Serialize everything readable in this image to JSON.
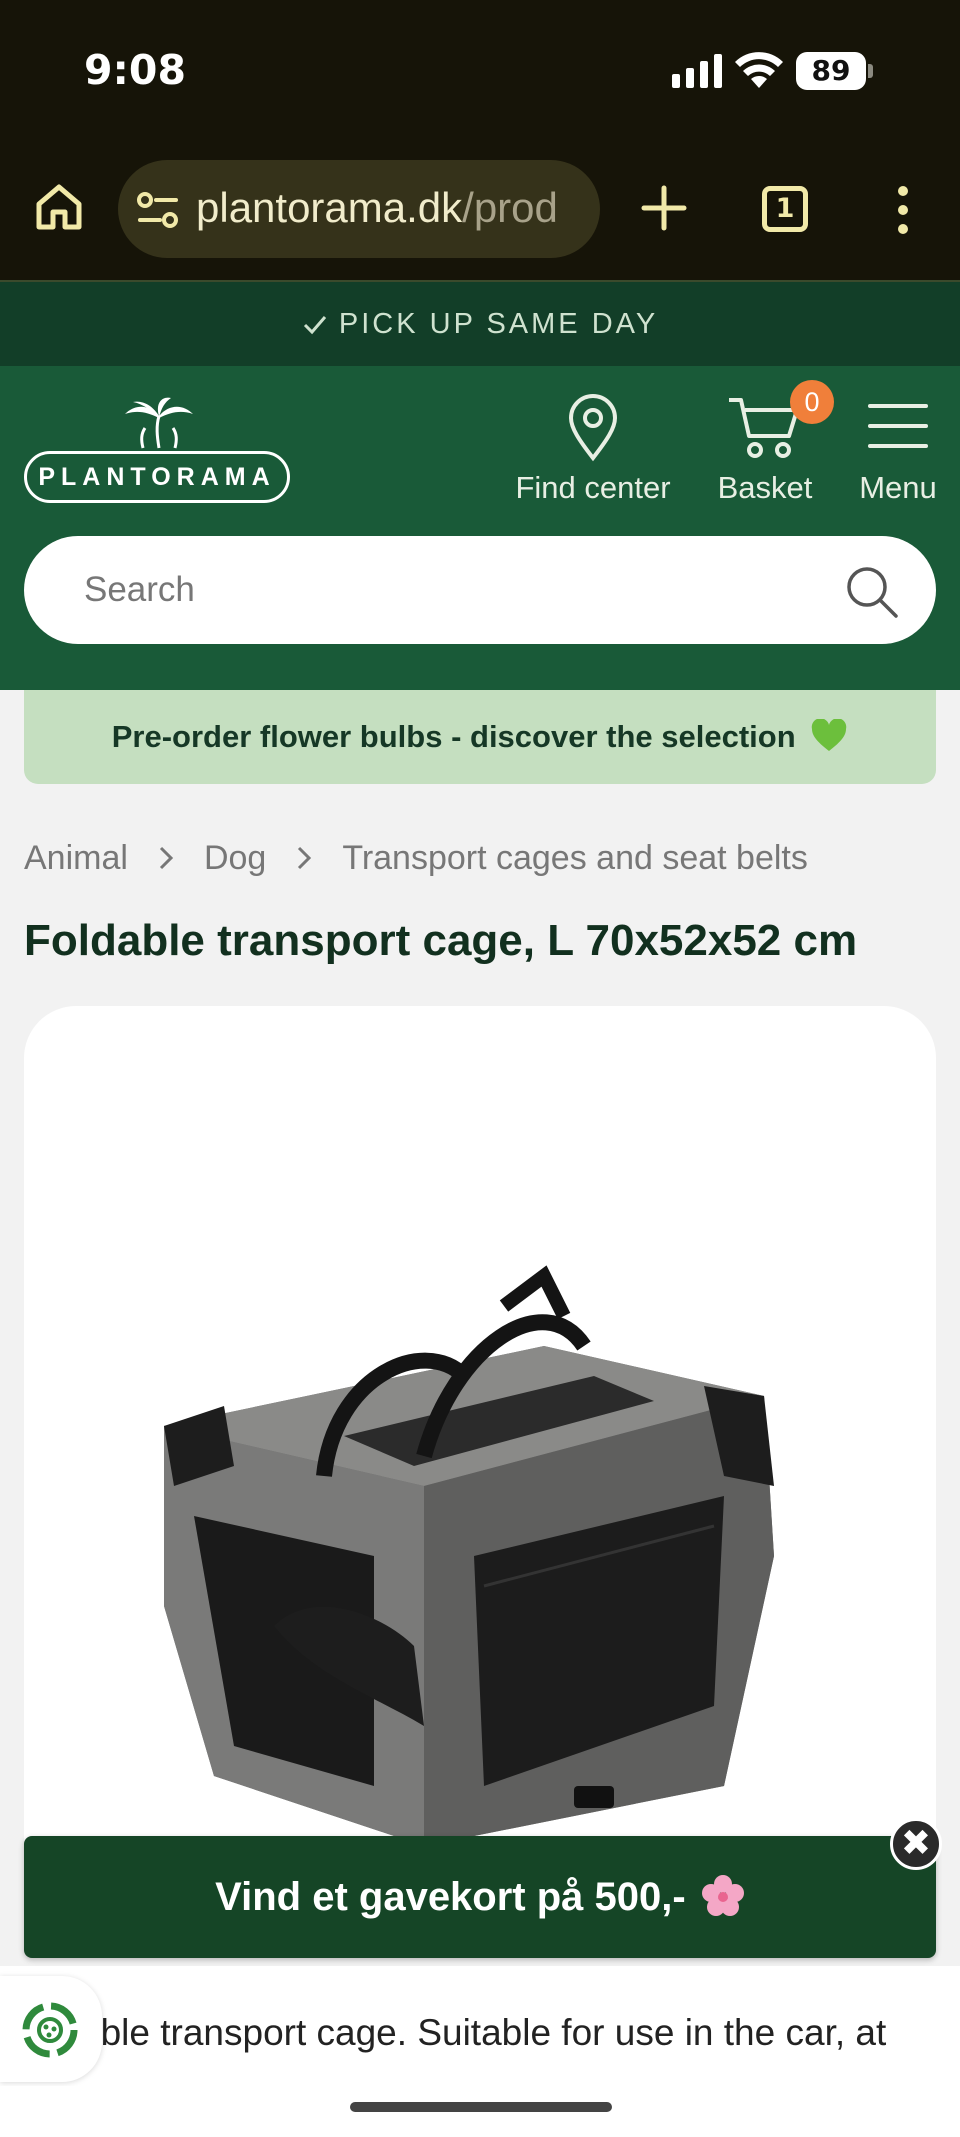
{
  "status_bar": {
    "time": "9:08",
    "battery": "89",
    "icons": [
      "signal-icon",
      "wifi-icon",
      "battery-icon"
    ]
  },
  "browser": {
    "url_host": "plantorama.dk",
    "url_path": "/prod",
    "tab_count": "1",
    "icons": [
      "home-icon",
      "site-settings-icon",
      "new-tab-icon",
      "tabs-icon",
      "more-icon"
    ]
  },
  "site": {
    "pickup_banner": "PICK UP SAME DAY",
    "logo_text": "PLANTORAMA",
    "nav": {
      "find_center": "Find center",
      "basket": "Basket",
      "basket_count": "0",
      "menu": "Menu"
    },
    "search": {
      "placeholder": "Search"
    },
    "promo": "Pre-order flower bulbs - discover the selection",
    "colors": {
      "header_green": "#195a38",
      "pickup_green": "#123e28",
      "promo_green": "#c5dfc0",
      "badge_orange": "#f07f3a",
      "gift_banner_green": "#154526"
    }
  },
  "breadcrumb": [
    "Animal",
    "Dog",
    "Transport cages and seat belts"
  ],
  "product": {
    "title": "Foldable transport cage, L 70x52x52 cm",
    "description": "able transport cage. Suitable for use in the car, at"
  },
  "gift_banner": {
    "text": "Vind et gavekort på 500,-",
    "close": "✖"
  }
}
